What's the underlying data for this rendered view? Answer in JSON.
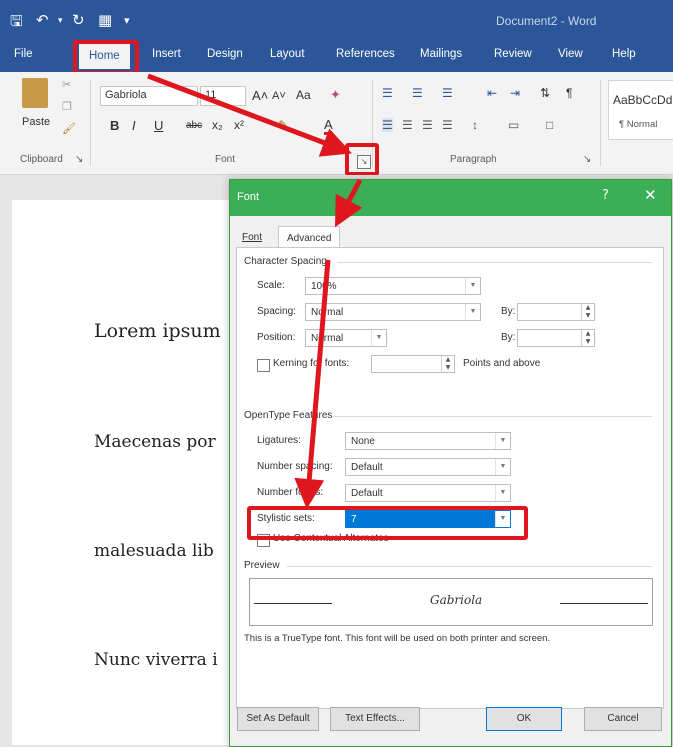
{
  "titlebar": {
    "doc_title": "Document2  -  Word",
    "quick_access": [
      "save-icon",
      "undo-icon",
      "redo-icon",
      "touch-icon",
      "customize-icon"
    ]
  },
  "tabs": [
    "File",
    "Home",
    "Insert",
    "Design",
    "Layout",
    "References",
    "Mailings",
    "Review",
    "View",
    "Help"
  ],
  "ribbon": {
    "clipboard": {
      "paste_label": "Paste",
      "group_label": "Clipboard"
    },
    "font": {
      "font_name": "Gabriola",
      "font_size": "11",
      "grow_label": "A˄",
      "shrink_label": "A˅",
      "case_label": "Aa",
      "bold": "B",
      "italic": "I",
      "underline": "U",
      "strike": "abc",
      "subscript": "x₂",
      "superscript": "x²",
      "font_color": "A",
      "group_label": "Font"
    },
    "paragraph": {
      "group_label": "Paragraph"
    },
    "styles": {
      "sample": "AaBbCcDd",
      "normal_label": "¶ Normal"
    }
  },
  "document": {
    "lines": [
      "Lorem ipsum",
      "Maecenas por",
      "malesuada lib",
      "Nunc viverra i"
    ]
  },
  "dialog": {
    "title": "Font",
    "help": "?",
    "close": "✕",
    "tabs": [
      "Font",
      "Advanced"
    ],
    "active_tab": "Advanced",
    "character_spacing": {
      "heading": "Character Spacing",
      "scale_label": "Scale:",
      "scale_value": "100%",
      "spacing_label": "Spacing:",
      "spacing_value": "Normal",
      "position_label": "Position:",
      "position_value": "Normal",
      "by_label": "By:",
      "kerning_label": "Kerning for fonts:",
      "points_label": "Points and above"
    },
    "opentype": {
      "heading": "OpenType Features",
      "ligatures_label": "Ligatures:",
      "ligatures_value": "None",
      "number_spacing_label": "Number spacing:",
      "number_spacing_value": "Default",
      "number_forms_label": "Number forms:",
      "number_forms_value": "Default",
      "stylistic_sets_label": "Stylistic sets:",
      "stylistic_sets_value": "7",
      "contextual_label": "Use Contextual Alternates"
    },
    "preview": {
      "heading": "Preview",
      "sample": "Gabriola",
      "note": "This is a TrueType font. This font will be used on both printer and screen."
    },
    "buttons": {
      "set_default": "Set As Default",
      "text_effects": "Text Effects...",
      "ok": "OK",
      "cancel": "Cancel"
    }
  },
  "colors": {
    "title_blue": "#2b579a",
    "dialog_green": "#3cae56",
    "highlight_red": "#e0161f",
    "selection_blue": "#0078d7"
  }
}
